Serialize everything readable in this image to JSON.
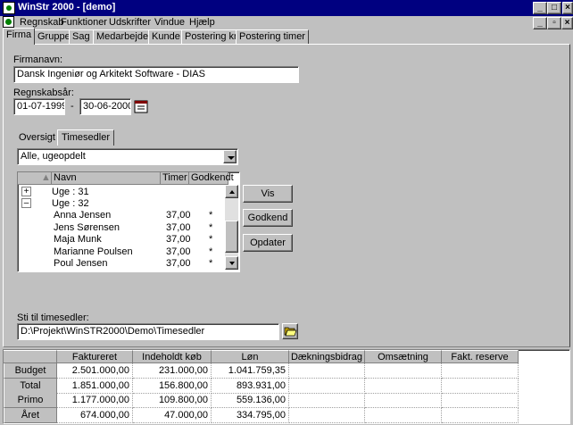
{
  "window": {
    "title": "WinStr 2000 - [demo]"
  },
  "menu": [
    "Regnskab",
    "Funktioner",
    "Udskrifter",
    "Vindue",
    "Hjælp"
  ],
  "tabs": [
    "Firma",
    "Gruppe",
    "Sag",
    "Medarbejder",
    "Kunde",
    "Postering kr.",
    "Postering timer"
  ],
  "firm": {
    "name_label": "Firmanavn:",
    "name_value": "Dansk Ingeniør og Arkitekt Software - DIAS",
    "year_label": "Regnskabsår:",
    "year_from": "01-07-1999",
    "year_sep": "-",
    "year_to": "30-06-2000"
  },
  "subtabs": [
    "Oversigt",
    "Timesedler"
  ],
  "filter": {
    "selected": "Alle, ugeopdelt"
  },
  "grid": {
    "columns": [
      "Navn",
      "Timer",
      "Godkendt"
    ],
    "groups": [
      {
        "label": "Uge : 31",
        "expander": "+"
      },
      {
        "label": "Uge : 32",
        "expander": "–"
      }
    ],
    "rows": [
      {
        "name": "Anna Jensen",
        "hours": "37,00",
        "approved": "*"
      },
      {
        "name": "Jens Sørensen",
        "hours": "37,00",
        "approved": "*"
      },
      {
        "name": "Maja Munk",
        "hours": "37,00",
        "approved": "*"
      },
      {
        "name": "Marianne Poulsen",
        "hours": "37,00",
        "approved": "*"
      },
      {
        "name": "Poul Jensen",
        "hours": "37,00",
        "approved": "*"
      }
    ]
  },
  "buttons": {
    "vis": "Vis",
    "godkend": "Godkend",
    "opdater": "Opdater"
  },
  "path": {
    "label": "Sti til timesedler:",
    "value": "D:\\Projekt\\WinSTR2000\\Demo\\Timesedler"
  },
  "summary": {
    "columns": [
      "Faktureret",
      "Indeholdt køb",
      "Løn",
      "Dækningsbidrag",
      "Omsætning",
      "Fakt. reserve"
    ],
    "rows": [
      {
        "label": "Budget",
        "values": [
          "2.501.000,00",
          "231.000,00",
          "1.041.759,35",
          "",
          "",
          ""
        ]
      },
      {
        "label": "Total",
        "values": [
          "1.851.000,00",
          "156.800,00",
          "893.931,00",
          "",
          "",
          ""
        ]
      },
      {
        "label": "Primo",
        "values": [
          "1.177.000,00",
          "109.800,00",
          "559.136,00",
          "",
          "",
          ""
        ]
      },
      {
        "label": "Året",
        "values": [
          "674.000,00",
          "47.000,00",
          "334.795,00",
          "",
          "",
          ""
        ]
      }
    ]
  },
  "icons": {
    "app": "app-icon",
    "calendar": "calendar-icon",
    "folder": "folder-open-icon"
  }
}
